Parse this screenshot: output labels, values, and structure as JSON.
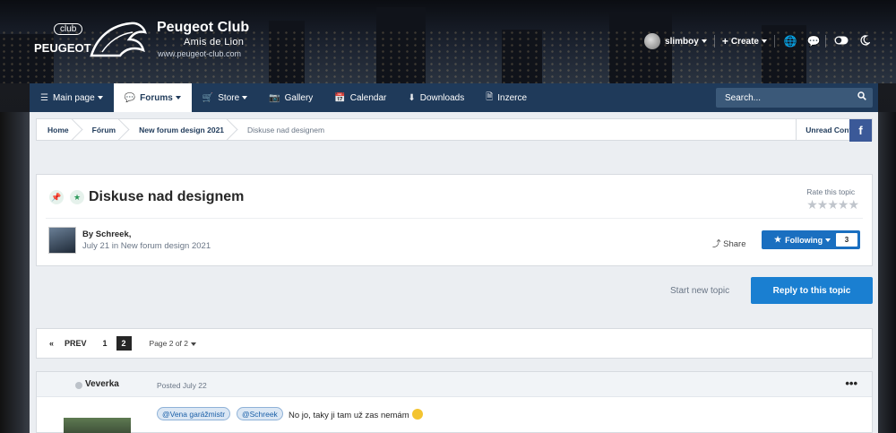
{
  "brand": {
    "logo_top": "club",
    "logo_bottom": "PEUGEOT",
    "title": "Peugeot Club",
    "subtitle": "Amis de Lion",
    "url": "www.peugeot-club.com"
  },
  "user": {
    "name": "slimboy",
    "create_label": "Create",
    "icons": [
      "globe-icon",
      "chat-icon",
      "toggle-icon",
      "moon-icon"
    ]
  },
  "nav": {
    "tabs": [
      {
        "label": "Main page",
        "icon": "menu-icon",
        "dropdown": true
      },
      {
        "label": "Forums",
        "icon": "comments-icon",
        "dropdown": true,
        "active": true
      },
      {
        "label": "Store",
        "icon": "cart-icon",
        "dropdown": true
      },
      {
        "label": "Gallery",
        "icon": "camera-icon"
      },
      {
        "label": "Calendar",
        "icon": "calendar-icon"
      },
      {
        "label": "Downloads",
        "icon": "download-icon"
      },
      {
        "label": "Inzerce",
        "icon": "file-icon"
      }
    ],
    "search_placeholder": "Search..."
  },
  "breadcrumb": {
    "items": [
      "Home",
      "Fórum",
      "New forum design 2021",
      "Diskuse nad designem"
    ],
    "unread": "Unread Content",
    "facebook": "f"
  },
  "topic": {
    "title": "Diskuse nad designem",
    "rate_label": "Rate this topic",
    "stars": "★★★★★",
    "by": "By Schreek,",
    "meta": "July 21 in New forum design 2021",
    "share": "Share",
    "following_label": "Following",
    "following_count": "3"
  },
  "actions": {
    "start_new": "Start new topic",
    "reply": "Reply to this topic"
  },
  "pagination": {
    "prev_icon": "«",
    "prev": "PREV",
    "pages": [
      "1",
      "2"
    ],
    "current_page": "2",
    "page_of": "Page 2 of 2"
  },
  "post": {
    "author": "Veverka",
    "posted": "Posted July 22",
    "menu": "•••",
    "mentions": [
      "@Vena garážmistr",
      "@Schreek"
    ],
    "text": "No jo, taky ji tam už zas nemám"
  },
  "colors": {
    "nav_bg": "#1f3a5a",
    "accent": "#1a7fd1",
    "facebook": "#3b5998"
  }
}
